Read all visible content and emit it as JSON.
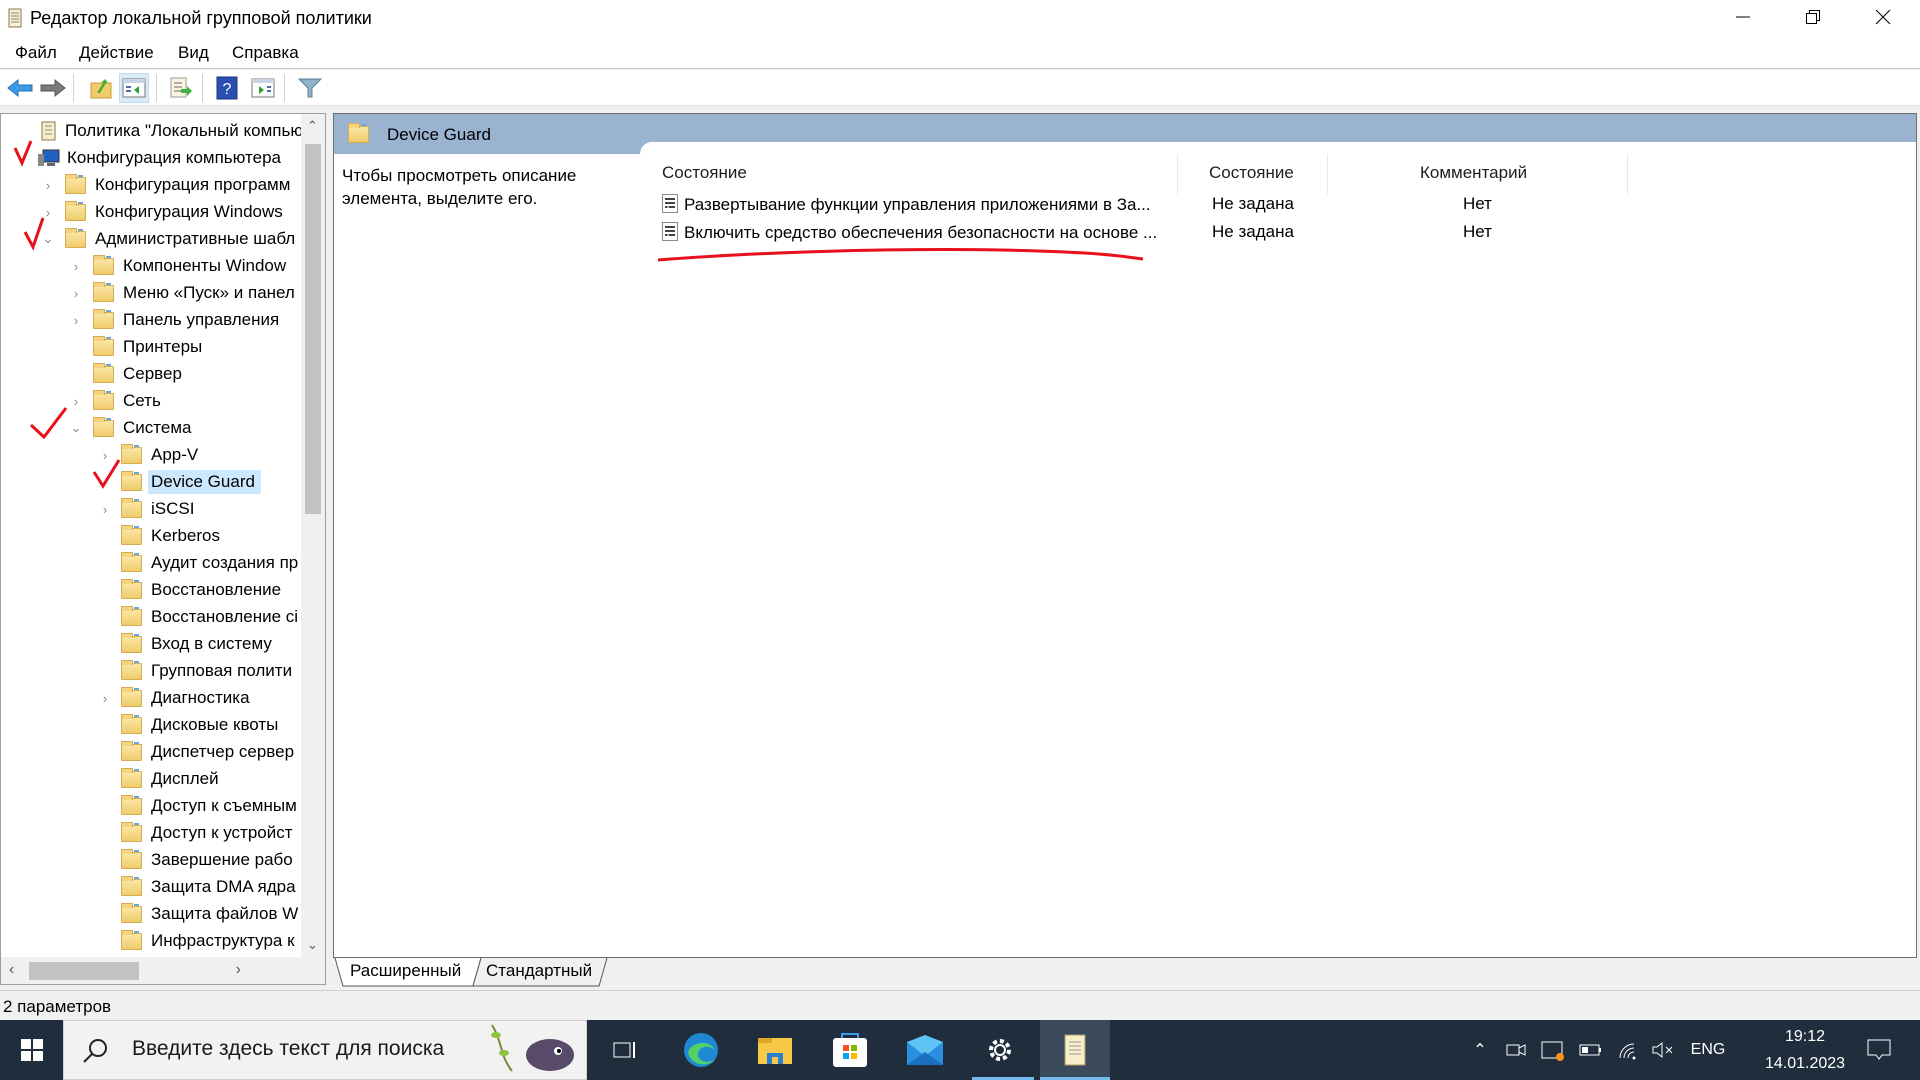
{
  "window": {
    "title": "Редактор локальной групповой политики",
    "controls": [
      "minimize",
      "restore",
      "close"
    ]
  },
  "menu": [
    "Файл",
    "Действие",
    "Вид",
    "Справка"
  ],
  "toolbar": {
    "buttons": [
      "back-icon",
      "forward-icon",
      "up-folder-icon",
      "show-hide-tree-icon",
      "export-list-icon",
      "help-icon",
      "show-action-pane-icon",
      "filter-icon"
    ],
    "active": "show-hide-tree-icon"
  },
  "tree": {
    "items": [
      {
        "label": "Политика \"Локальный компьют",
        "level": 0,
        "icon": "policy-icon",
        "expander": "none"
      },
      {
        "label": "Конфигурация компьютера",
        "level": 1,
        "icon": "computer-icon",
        "expander": "none"
      },
      {
        "label": "Конфигурация программ",
        "level": 2,
        "icon": "folder-icon",
        "expander": "collapsed"
      },
      {
        "label": "Конфигурация Windows",
        "level": 2,
        "icon": "folder-icon",
        "expander": "collapsed"
      },
      {
        "label": "Административные шабл",
        "level": 2,
        "icon": "folder-icon",
        "expander": "expanded"
      },
      {
        "label": "Компоненты Window",
        "level": 3,
        "icon": "folder-icon",
        "expander": "collapsed"
      },
      {
        "label": "Меню «Пуск» и панел",
        "level": 3,
        "icon": "folder-icon",
        "expander": "collapsed"
      },
      {
        "label": "Панель управления",
        "level": 3,
        "icon": "folder-icon",
        "expander": "collapsed"
      },
      {
        "label": "Принтеры",
        "level": 3,
        "icon": "folder-icon",
        "expander": "none"
      },
      {
        "label": "Сервер",
        "level": 3,
        "icon": "folder-icon",
        "expander": "none"
      },
      {
        "label": "Сеть",
        "level": 3,
        "icon": "folder-icon",
        "expander": "collapsed"
      },
      {
        "label": "Система",
        "level": 3,
        "icon": "folder-icon",
        "expander": "expanded"
      },
      {
        "label": "App-V",
        "level": 4,
        "icon": "folder-icon",
        "expander": "collapsed"
      },
      {
        "label": "Device Guard",
        "level": 4,
        "icon": "folder-icon",
        "expander": "none",
        "selected": true
      },
      {
        "label": "iSCSI",
        "level": 4,
        "icon": "folder-icon",
        "expander": "collapsed"
      },
      {
        "label": "Kerberos",
        "level": 4,
        "icon": "folder-icon",
        "expander": "none"
      },
      {
        "label": "Аудит создания пр",
        "level": 4,
        "icon": "folder-icon",
        "expander": "none"
      },
      {
        "label": "Восстановление",
        "level": 4,
        "icon": "folder-icon",
        "expander": "none"
      },
      {
        "label": "Восстановление сі",
        "level": 4,
        "icon": "folder-icon",
        "expander": "none"
      },
      {
        "label": "Вход в систему",
        "level": 4,
        "icon": "folder-icon",
        "expander": "none"
      },
      {
        "label": "Групповая полити",
        "level": 4,
        "icon": "folder-icon",
        "expander": "none"
      },
      {
        "label": "Диагностика",
        "level": 4,
        "icon": "folder-icon",
        "expander": "collapsed"
      },
      {
        "label": "Дисковые квоты",
        "level": 4,
        "icon": "folder-icon",
        "expander": "none"
      },
      {
        "label": "Диспетчер сервер",
        "level": 4,
        "icon": "folder-icon",
        "expander": "none"
      },
      {
        "label": "Дисплей",
        "level": 4,
        "icon": "folder-icon",
        "expander": "none"
      },
      {
        "label": "Доступ к съемным",
        "level": 4,
        "icon": "folder-icon",
        "expander": "none"
      },
      {
        "label": "Доступ к устройст",
        "level": 4,
        "icon": "folder-icon",
        "expander": "none"
      },
      {
        "label": "Завершение рабо",
        "level": 4,
        "icon": "folder-icon",
        "expander": "none"
      },
      {
        "label": "Защита DMA ядра",
        "level": 4,
        "icon": "folder-icon",
        "expander": "none"
      },
      {
        "label": "Защита файлов W",
        "level": 4,
        "icon": "folder-icon",
        "expander": "none"
      },
      {
        "label": "Инфраструктура к",
        "level": 4,
        "icon": "folder-icon",
        "expander": "none"
      }
    ]
  },
  "details": {
    "header_title": "Device Guard",
    "description": [
      "Чтобы просмотреть описание",
      "элемента, выделите его."
    ],
    "columns": [
      "Состояние",
      "Состояние",
      "Комментарий"
    ],
    "rows": [
      {
        "name": "Развертывание функции управления приложениями в За...",
        "state": "Не задана",
        "comment": "Нет"
      },
      {
        "name": "Включить средство обеспечения безопасности на основе ...",
        "state": "Не задана",
        "comment": "Нет"
      }
    ]
  },
  "view_tabs": [
    "Расширенный",
    "Стандартный"
  ],
  "active_view_tab": "Расширенный",
  "status": "2 параметров",
  "taskbar": {
    "search_placeholder": "Введите здесь текст для поиска",
    "apps": [
      "task-view-icon",
      "edge-icon",
      "file-explorer-icon",
      "store-icon",
      "mail-icon",
      "settings-icon",
      "gpedit-icon"
    ],
    "tray": {
      "language": "ENG",
      "time": "19:12",
      "date": "14.01.2023"
    }
  },
  "colors": {
    "header_band": "#9ab3d1",
    "selection": "#cce8ff",
    "taskbar": "#1f2d3c",
    "annotation": "#e8101a"
  }
}
